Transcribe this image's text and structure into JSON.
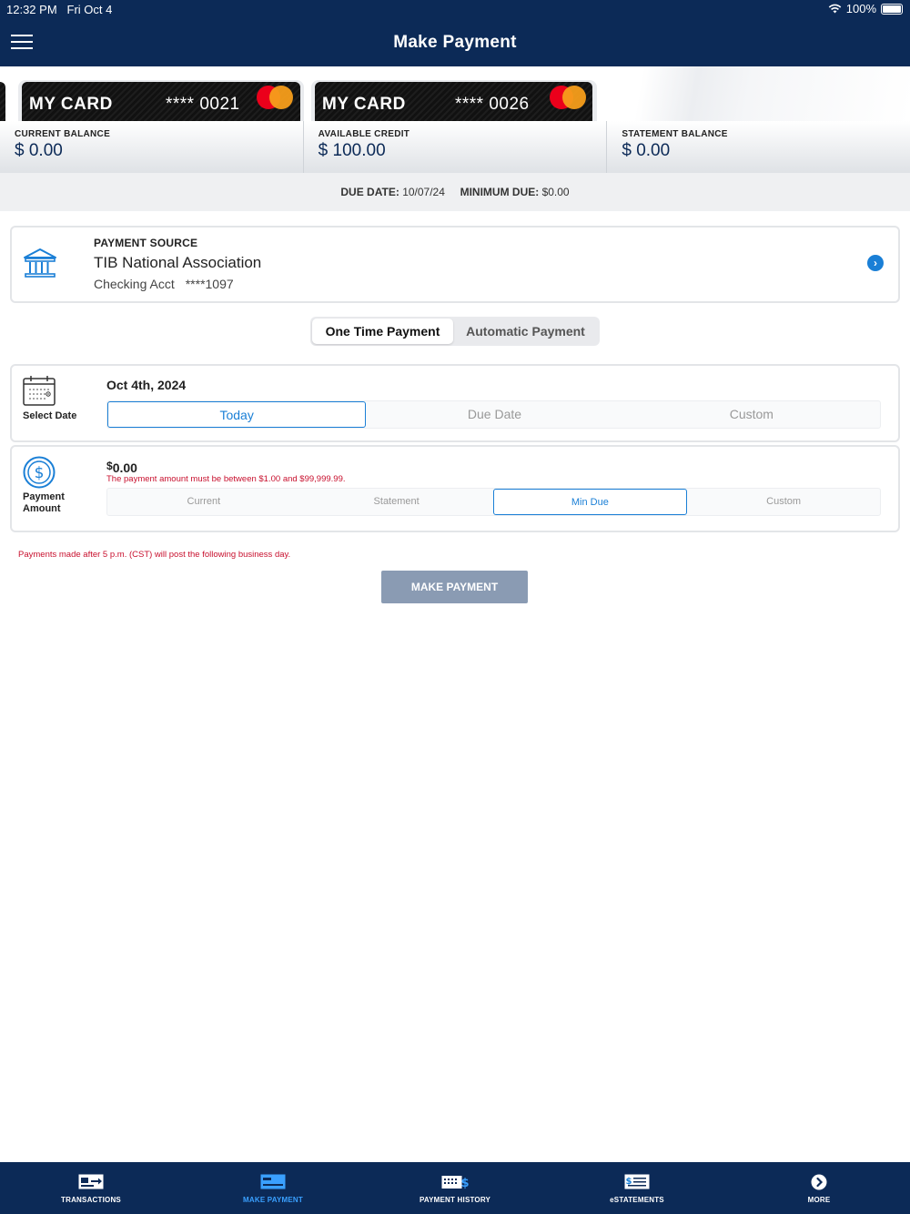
{
  "status_bar": {
    "time": "12:32 PM",
    "date": "Fri Oct 4",
    "battery": "100%"
  },
  "header": {
    "title": "Make Payment"
  },
  "cards": [
    {
      "name": "MY CARD",
      "number": "**** 0021"
    },
    {
      "name": "MY CARD",
      "number": "**** 0026"
    }
  ],
  "balances": [
    {
      "label": "CURRENT BALANCE",
      "value": "$ 0.00"
    },
    {
      "label": "AVAILABLE CREDIT",
      "value": "$ 100.00"
    },
    {
      "label": "STATEMENT BALANCE",
      "value": "$ 0.00"
    }
  ],
  "due": {
    "due_label": "DUE DATE:",
    "due_value": "10/07/24",
    "min_label": "MINIMUM DUE:",
    "min_value": "$0.00"
  },
  "payment_source": {
    "label": "PAYMENT SOURCE",
    "bank": "TIB National Association",
    "account_type": "Checking Acct",
    "account_number": "****1097"
  },
  "payment_tabs": {
    "one_time": "One Time Payment",
    "automatic": "Automatic Payment"
  },
  "select_date": {
    "caption": "Select Date",
    "value": "Oct 4th, 2024",
    "options": [
      "Today",
      "Due Date",
      "Custom"
    ],
    "selected": "Today"
  },
  "payment_amount": {
    "caption_line1": "Payment",
    "caption_line2": "Amount",
    "currency": "$",
    "value": "0.00",
    "error": "The payment amount must be between $1.00 and $99,999.99.",
    "options": [
      "Current",
      "Statement",
      "Min Due",
      "Custom"
    ],
    "selected": "Min Due"
  },
  "notice": "Payments made after 5 p.m. (CST) will post the following business day.",
  "make_payment_button": "MAKE PAYMENT",
  "bottom_nav": [
    {
      "label": "TRANSACTIONS",
      "icon": "transactions-icon"
    },
    {
      "label": "MAKE PAYMENT",
      "icon": "make-payment-icon",
      "active": true
    },
    {
      "label": "PAYMENT HISTORY",
      "icon": "payment-history-icon"
    },
    {
      "label": "eSTATEMENTS",
      "icon": "estatements-icon"
    },
    {
      "label": "MORE",
      "icon": "more-icon"
    }
  ],
  "colors": {
    "navy": "#0c2a57",
    "accent_blue": "#1a7fd6",
    "error_red": "#c8102e",
    "disabled_button": "#8a9bb3"
  }
}
